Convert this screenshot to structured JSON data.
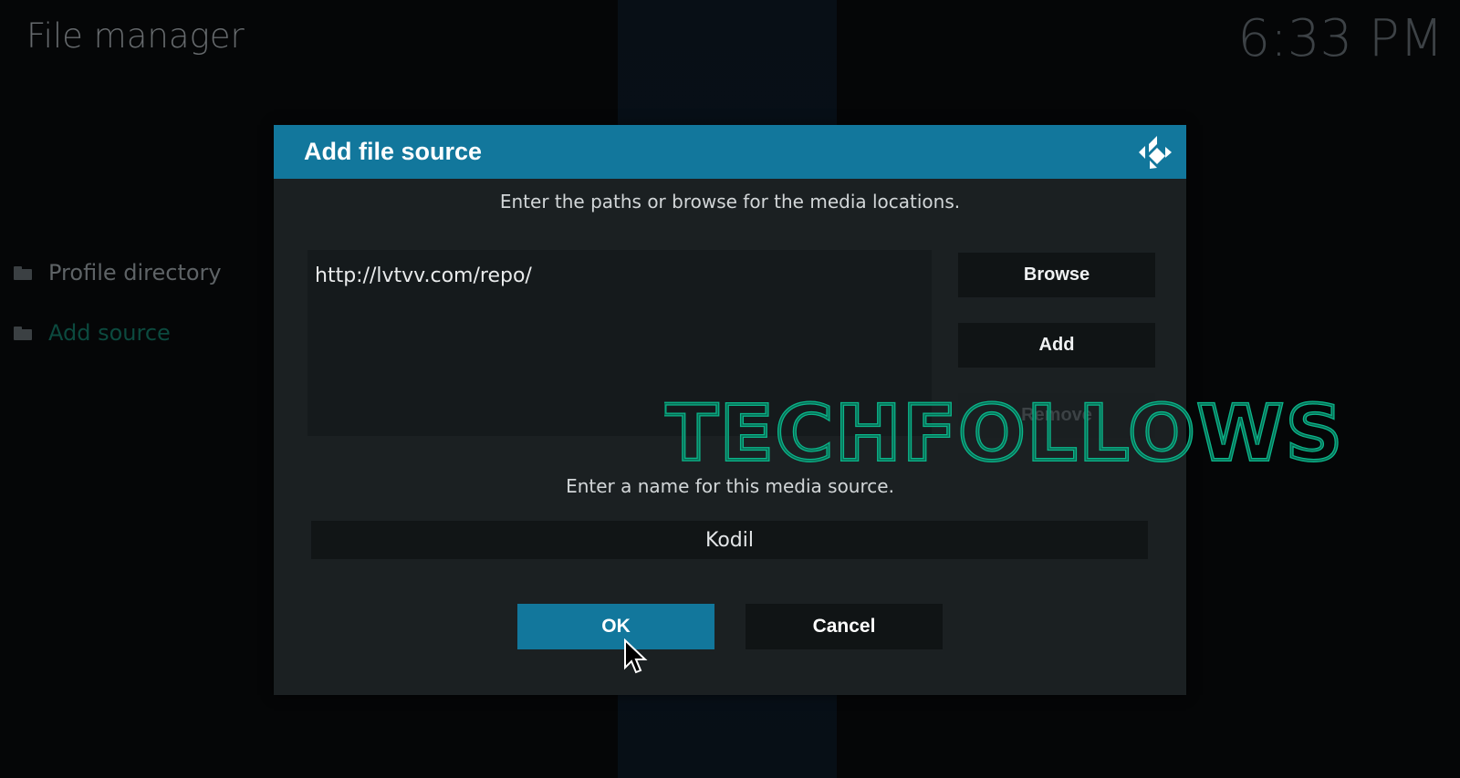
{
  "app": {
    "title": "File manager",
    "clock": "6:33 PM"
  },
  "sidebar": {
    "items": [
      {
        "label": "Profile directory",
        "icon": "folder-icon"
      },
      {
        "label": "Add source",
        "icon": "folder-icon",
        "active": true
      }
    ]
  },
  "dialog": {
    "title": "Add file source",
    "path_instruction": "Enter the paths or browse for the media locations.",
    "paths": [
      "http://lvtvv.com/repo/"
    ],
    "buttons": {
      "browse": "Browse",
      "add": "Add",
      "remove": "Remove"
    },
    "name_instruction": "Enter a name for this media source.",
    "name_value": "Kodil",
    "ok": "OK",
    "cancel": "Cancel"
  },
  "watermark": {
    "text": "TECHFOLLOWS"
  },
  "colors": {
    "accent": "#12779c",
    "watermark": "#0bb58a",
    "active_sidebar": "#0c4a3f"
  }
}
